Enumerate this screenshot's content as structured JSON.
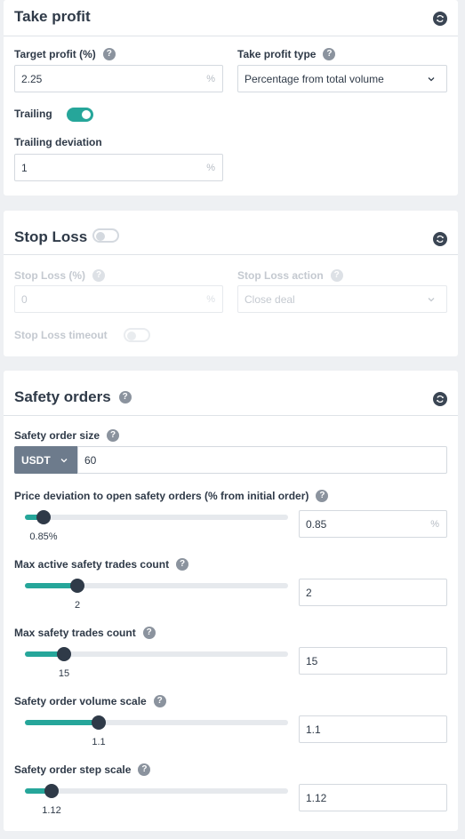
{
  "take_profit": {
    "title": "Take profit",
    "target_label": "Target profit (%)",
    "target_value": "2.25",
    "target_suffix": "%",
    "type_label": "Take profit type",
    "type_value": "Percentage from total volume",
    "trailing_label": "Trailing",
    "trailing_on": true,
    "trailing_deviation_label": "Trailing deviation",
    "trailing_deviation_value": "1",
    "trailing_deviation_suffix": "%"
  },
  "stop_loss": {
    "title": "Stop Loss",
    "enabled": false,
    "percent_label": "Stop Loss (%)",
    "percent_value": "0",
    "percent_suffix": "%",
    "action_label": "Stop Loss action",
    "action_value": "Close deal",
    "timeout_label": "Stop Loss timeout",
    "timeout_on": false
  },
  "safety_orders": {
    "title": "Safety orders",
    "size_label": "Safety order size",
    "size_currency": "USDT",
    "size_value": "60",
    "price_deviation": {
      "label": "Price deviation to open safety orders (% from initial order)",
      "slider_text": "0.85%",
      "fraction": 0.07,
      "value": "0.85",
      "suffix": "%"
    },
    "max_active": {
      "label": "Max active safety trades count",
      "slider_text": "2",
      "fraction": 0.2,
      "value": "2"
    },
    "max_trades": {
      "label": "Max safety trades count",
      "slider_text": "15",
      "fraction": 0.15,
      "value": "15"
    },
    "volume_scale": {
      "label": "Safety order volume scale",
      "slider_text": "1.1",
      "fraction": 0.28,
      "value": "1.1"
    },
    "step_scale": {
      "label": "Safety order step scale",
      "slider_text": "1.12",
      "fraction": 0.1,
      "value": "1.12"
    }
  },
  "icons": {
    "help": "?",
    "sync": "sync-icon",
    "dropdown": "chevron-down-icon"
  },
  "colors": {
    "accent": "#26a69a",
    "text": "#2f3a48",
    "usdt_bg": "#6d7b8c",
    "help_bg": "#8b939e"
  }
}
